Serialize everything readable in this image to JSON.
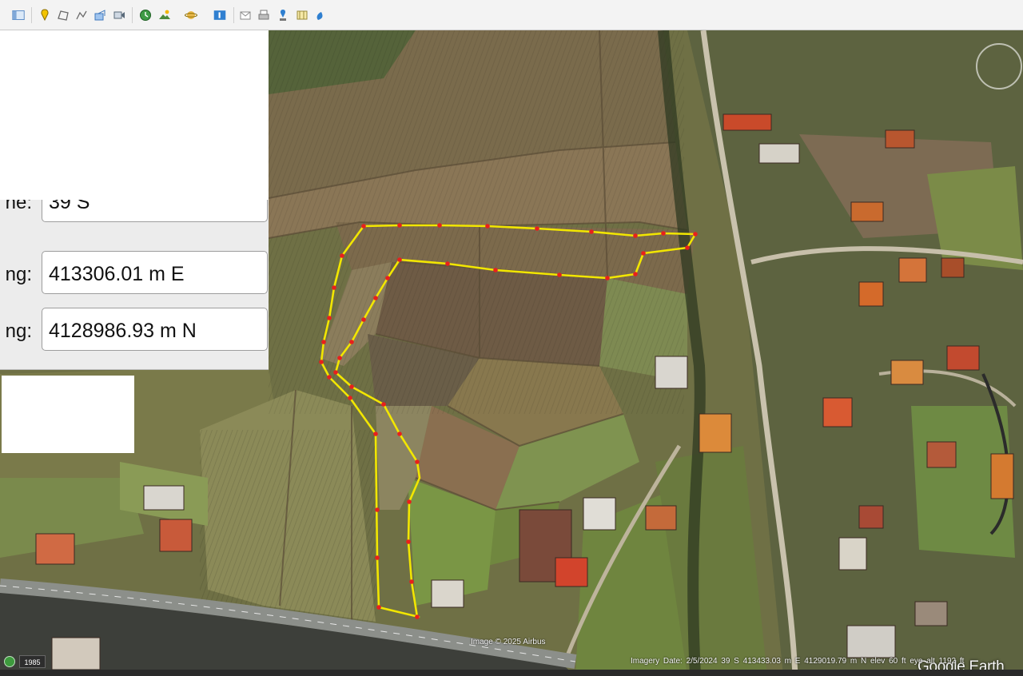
{
  "toolbar": {
    "buttons": [
      {
        "name": "sidebar-toggle-button",
        "icon": "sidebar-icon"
      },
      {
        "name": "add-placemark-button",
        "icon": "placemark-icon"
      },
      {
        "name": "add-polygon-button",
        "icon": "polygon-icon"
      },
      {
        "name": "add-path-button",
        "icon": "path-icon"
      },
      {
        "name": "add-overlay-button",
        "icon": "overlay-icon"
      },
      {
        "name": "record-tour-button",
        "icon": "tour-icon"
      },
      {
        "name": "historical-imagery-button",
        "icon": "clock-icon"
      },
      {
        "name": "sunlight-button",
        "icon": "sun-icon"
      },
      {
        "name": "switch-to-sky-button",
        "icon": "planet-icon"
      },
      {
        "name": "ruler-button",
        "icon": "ruler-icon"
      },
      {
        "name": "email-button",
        "icon": "email-icon"
      },
      {
        "name": "print-button",
        "icon": "print-icon"
      },
      {
        "name": "save-image-button",
        "icon": "image-icon"
      },
      {
        "name": "view-in-maps-button",
        "icon": "maps-icon"
      },
      {
        "name": "earth-gallery-button",
        "icon": "gallery-icon"
      }
    ]
  },
  "coords": {
    "zone_label": "ne:",
    "zone_value": "39 S",
    "easting_label": "ng:",
    "easting_value": "413306.01 m E",
    "northing_label": "ng:",
    "northing_value": "4128986.93 m N"
  },
  "map": {
    "attribution": "Image © 2025 Airbus",
    "watermark": "Google Earth",
    "path_color": "#f2e600",
    "vertex_color": "#e8201c"
  },
  "status": {
    "historical_year": "1985",
    "text": "Imagery Date: 2/5/2024   39 S 413433.03 m E 4129019.79 m N   elev   60 ft   eye alt  1192 ft"
  }
}
